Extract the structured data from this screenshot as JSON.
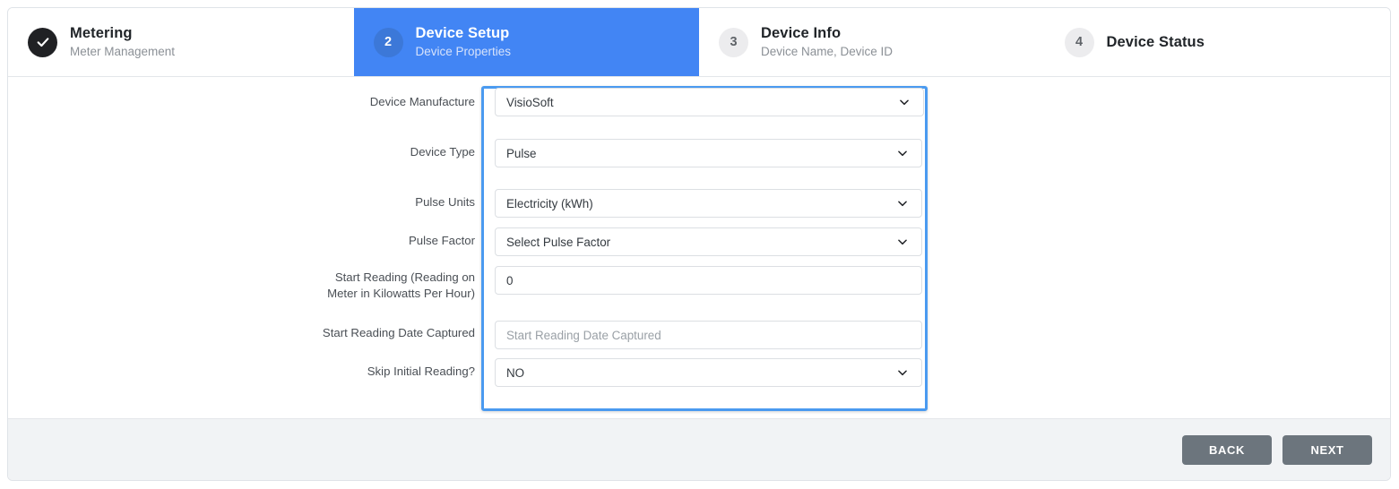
{
  "steps": [
    {
      "badge": "check-icon",
      "number": "",
      "title": "Metering",
      "subtitle": "Meter Management",
      "state": "done"
    },
    {
      "badge": "2",
      "number": "2",
      "title": "Device Setup",
      "subtitle": "Device Properties",
      "state": "active"
    },
    {
      "badge": "3",
      "number": "3",
      "title": "Device Info",
      "subtitle": "Device Name, Device ID",
      "state": "upcoming"
    },
    {
      "badge": "4",
      "number": "4",
      "title": "Device Status",
      "subtitle": "",
      "state": "upcoming"
    }
  ],
  "form": {
    "fields": [
      {
        "label": "Device Manufacture",
        "type": "select",
        "value": "VisioSoft",
        "icon": "chevron-down-icon"
      },
      {
        "label": "Device Type",
        "type": "select",
        "value": "Pulse",
        "icon": "chevron-down-icon"
      },
      {
        "label": "Pulse Units",
        "type": "select",
        "value": "Electricity (kWh)",
        "icon": "chevron-down-icon"
      },
      {
        "label": "Pulse Factor",
        "type": "select",
        "value": "Select Pulse Factor",
        "icon": "chevron-down-icon"
      },
      {
        "label": "Start Reading (Reading on Meter in Kilowatts Per Hour)",
        "type": "text",
        "value": "0",
        "placeholder": ""
      },
      {
        "label": "Start Reading Date Captured",
        "type": "text",
        "value": "",
        "placeholder": "Start Reading Date Captured"
      },
      {
        "label": "Skip Initial Reading?",
        "type": "select",
        "value": "NO",
        "icon": "chevron-down-icon"
      }
    ]
  },
  "footer": {
    "back_label": "BACK",
    "next_label": "NEXT"
  },
  "colors": {
    "active_step_bg": "#4285f4",
    "active_badge_bg": "#3c78d8",
    "done_badge_bg": "#202124",
    "focus_ring": "#4a9af0",
    "button_bg": "#6c757d",
    "footer_bg": "#f1f3f5"
  }
}
